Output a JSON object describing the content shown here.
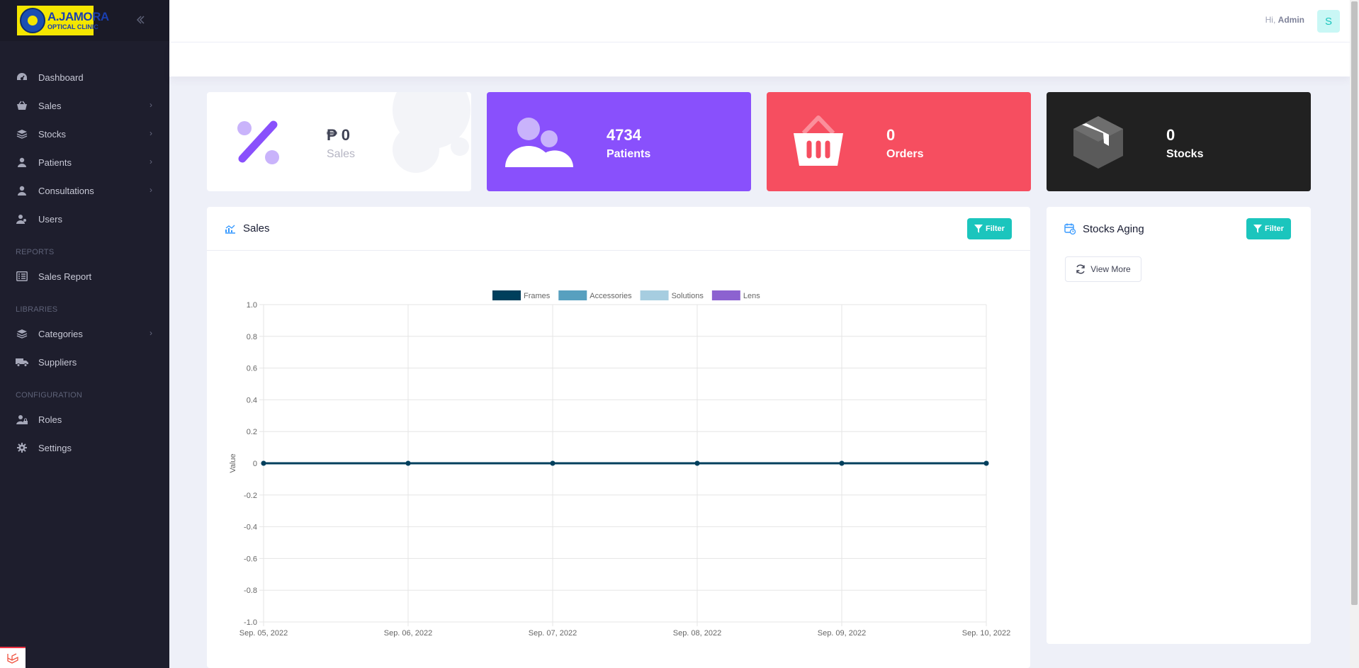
{
  "brand": {
    "logo_line1": "A.JAMORA",
    "logo_line2": "OPTICAL CLINIC"
  },
  "sidebar": {
    "items": [
      {
        "label": "Dashboard",
        "icon": "dashboard-icon",
        "has_submenu": false
      },
      {
        "label": "Sales",
        "icon": "basket-icon",
        "has_submenu": true
      },
      {
        "label": "Stocks",
        "icon": "layers-icon",
        "has_submenu": true
      },
      {
        "label": "Patients",
        "icon": "user-icon",
        "has_submenu": true
      },
      {
        "label": "Consultations",
        "icon": "user-icon",
        "has_submenu": true
      },
      {
        "label": "Users",
        "icon": "users-icon",
        "has_submenu": false
      }
    ],
    "reports_heading": "REPORTS",
    "reports_items": [
      {
        "label": "Sales Report",
        "icon": "list-icon"
      }
    ],
    "libraries_heading": "LIBRARIES",
    "libraries_items": [
      {
        "label": "Categories",
        "icon": "layers-icon",
        "has_submenu": true
      },
      {
        "label": "Suppliers",
        "icon": "truck-icon",
        "has_submenu": false
      }
    ],
    "config_heading": "CONFIGURATION",
    "config_items": [
      {
        "label": "Roles",
        "icon": "user-lock-icon"
      },
      {
        "label": "Settings",
        "icon": "gear-icon"
      }
    ]
  },
  "header": {
    "greeting": "Hi,",
    "user_name": "Admin",
    "avatar_initial": "S"
  },
  "stats": [
    {
      "value": "₱ 0",
      "label": "Sales",
      "icon": "percent-icon",
      "color": "#ffffff"
    },
    {
      "value": "4734",
      "label": "Patients",
      "icon": "users-icon",
      "color": "#8950fc"
    },
    {
      "value": "0",
      "label": "Orders",
      "icon": "basket-icon",
      "color": "#f64e60"
    },
    {
      "value": "0",
      "label": "Stocks",
      "icon": "box-icon",
      "color": "#212121"
    }
  ],
  "sales_panel": {
    "title": "Sales",
    "filter_label": "Filter"
  },
  "stocks_panel": {
    "title": "Stocks Aging",
    "filter_label": "Filter",
    "view_more_label": "View More"
  },
  "colors": {
    "accent": "#1bc5bd",
    "sidebar_bg": "#1e1e2d"
  },
  "chart_data": {
    "type": "line",
    "x": [
      "Sep. 05, 2022",
      "Sep. 06, 2022",
      "Sep. 07, 2022",
      "Sep. 08, 2022",
      "Sep. 09, 2022",
      "Sep. 10, 2022"
    ],
    "series": [
      {
        "name": "Frames",
        "values": [
          0,
          0,
          0,
          0,
          0,
          0
        ],
        "color": "#003f5c"
      },
      {
        "name": "Accessories",
        "values": [
          0,
          0,
          0,
          0,
          0,
          0
        ],
        "color": "#58a0bf"
      },
      {
        "name": "Solutions",
        "values": [
          0,
          0,
          0,
          0,
          0,
          0
        ],
        "color": "#a6cde0"
      },
      {
        "name": "Lens",
        "values": [
          0,
          0,
          0,
          0,
          0,
          0
        ],
        "color": "#8c62d0"
      }
    ],
    "yticks": [
      "1.0",
      "0.8",
      "0.6",
      "0.4",
      "0.2",
      "0",
      "-0.2",
      "-0.4",
      "-0.6",
      "-0.8",
      "-1.0"
    ],
    "ylabel": "Value",
    "ylim": [
      -1,
      1
    ],
    "grid": true,
    "legend": "top"
  }
}
